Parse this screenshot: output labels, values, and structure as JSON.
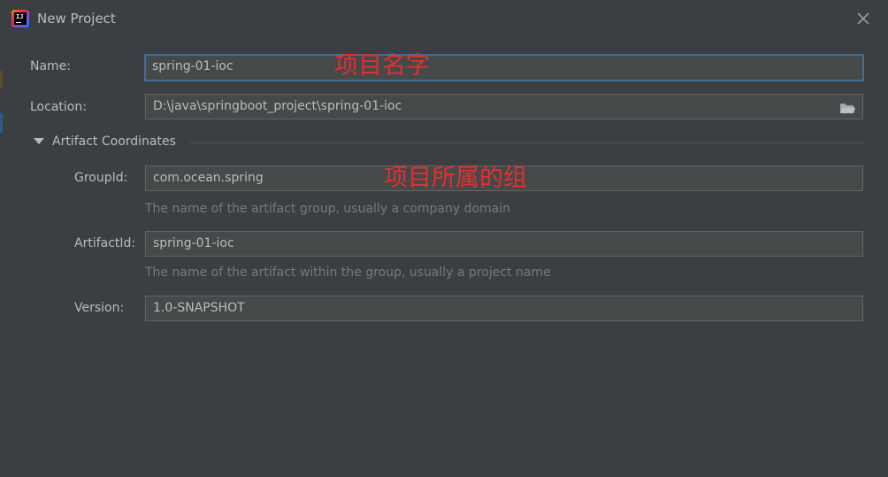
{
  "window": {
    "title": "New Project",
    "icon": "intellij-idea-icon",
    "close_icon": "close-icon"
  },
  "form": {
    "name": {
      "label": "Name:",
      "value": "spring-01-ioc"
    },
    "location": {
      "label": "Location:",
      "value": "D:\\java\\springboot_project\\spring-01-ioc",
      "browse_icon": "folder-icon"
    },
    "artifact_section": {
      "title": "Artifact Coordinates",
      "expanded": true,
      "group_id": {
        "label": "GroupId:",
        "value": "com.ocean.spring",
        "hint": "The name of the artifact group, usually a company domain"
      },
      "artifact_id": {
        "label": "ArtifactId:",
        "value": "spring-01-ioc",
        "hint": "The name of the artifact within the group, usually a project name"
      },
      "version": {
        "label": "Version:",
        "value": "1.0-SNAPSHOT"
      }
    }
  },
  "annotations": {
    "name_note": "项目名字",
    "group_note": "项目所属的组"
  },
  "colors": {
    "background": "#3c3f41",
    "field_background": "#45494a",
    "focus_border": "#466d94",
    "annotation": "#e62e2e"
  }
}
